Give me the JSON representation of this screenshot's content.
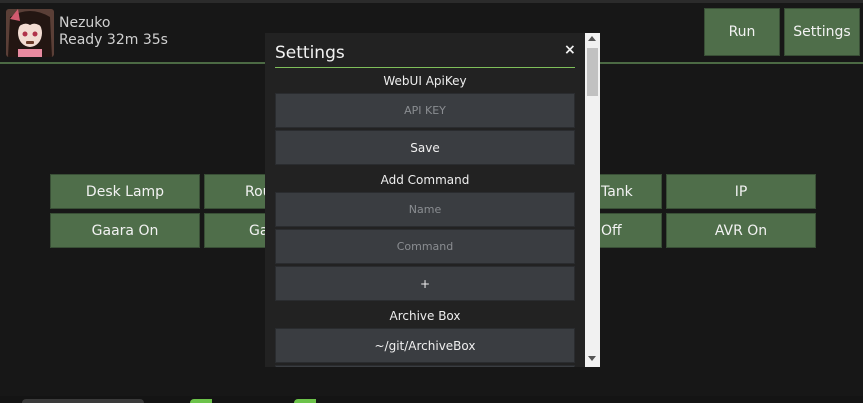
{
  "header": {
    "user_name": "Nezuko",
    "status": "Ready 32m 35s",
    "run_label": "Run",
    "settings_label": "Settings"
  },
  "grid": {
    "desk_lamp": "Desk Lamp",
    "rou_partial": "Rou",
    "tank_partial": "Tank",
    "ip": "IP",
    "gaara_on": "Gaara On",
    "ga_partial": "Ga",
    "off_partial": "Off",
    "avr_on": "AVR On"
  },
  "modal": {
    "title": "Settings",
    "close_glyph": "×",
    "webui_label": "WebUI ApiKey",
    "api_key_placeholder": "API KEY",
    "save_label": "Save",
    "add_command_label": "Add Command",
    "name_placeholder": "Name",
    "command_placeholder": "Command",
    "add_label": "+",
    "archive_label": "Archive Box",
    "archive_path": "~/git/ArchiveBox"
  },
  "colors": {
    "accent_green": "#4f6e4a",
    "divider_green": "#7fbf5a",
    "background": "#171717"
  }
}
